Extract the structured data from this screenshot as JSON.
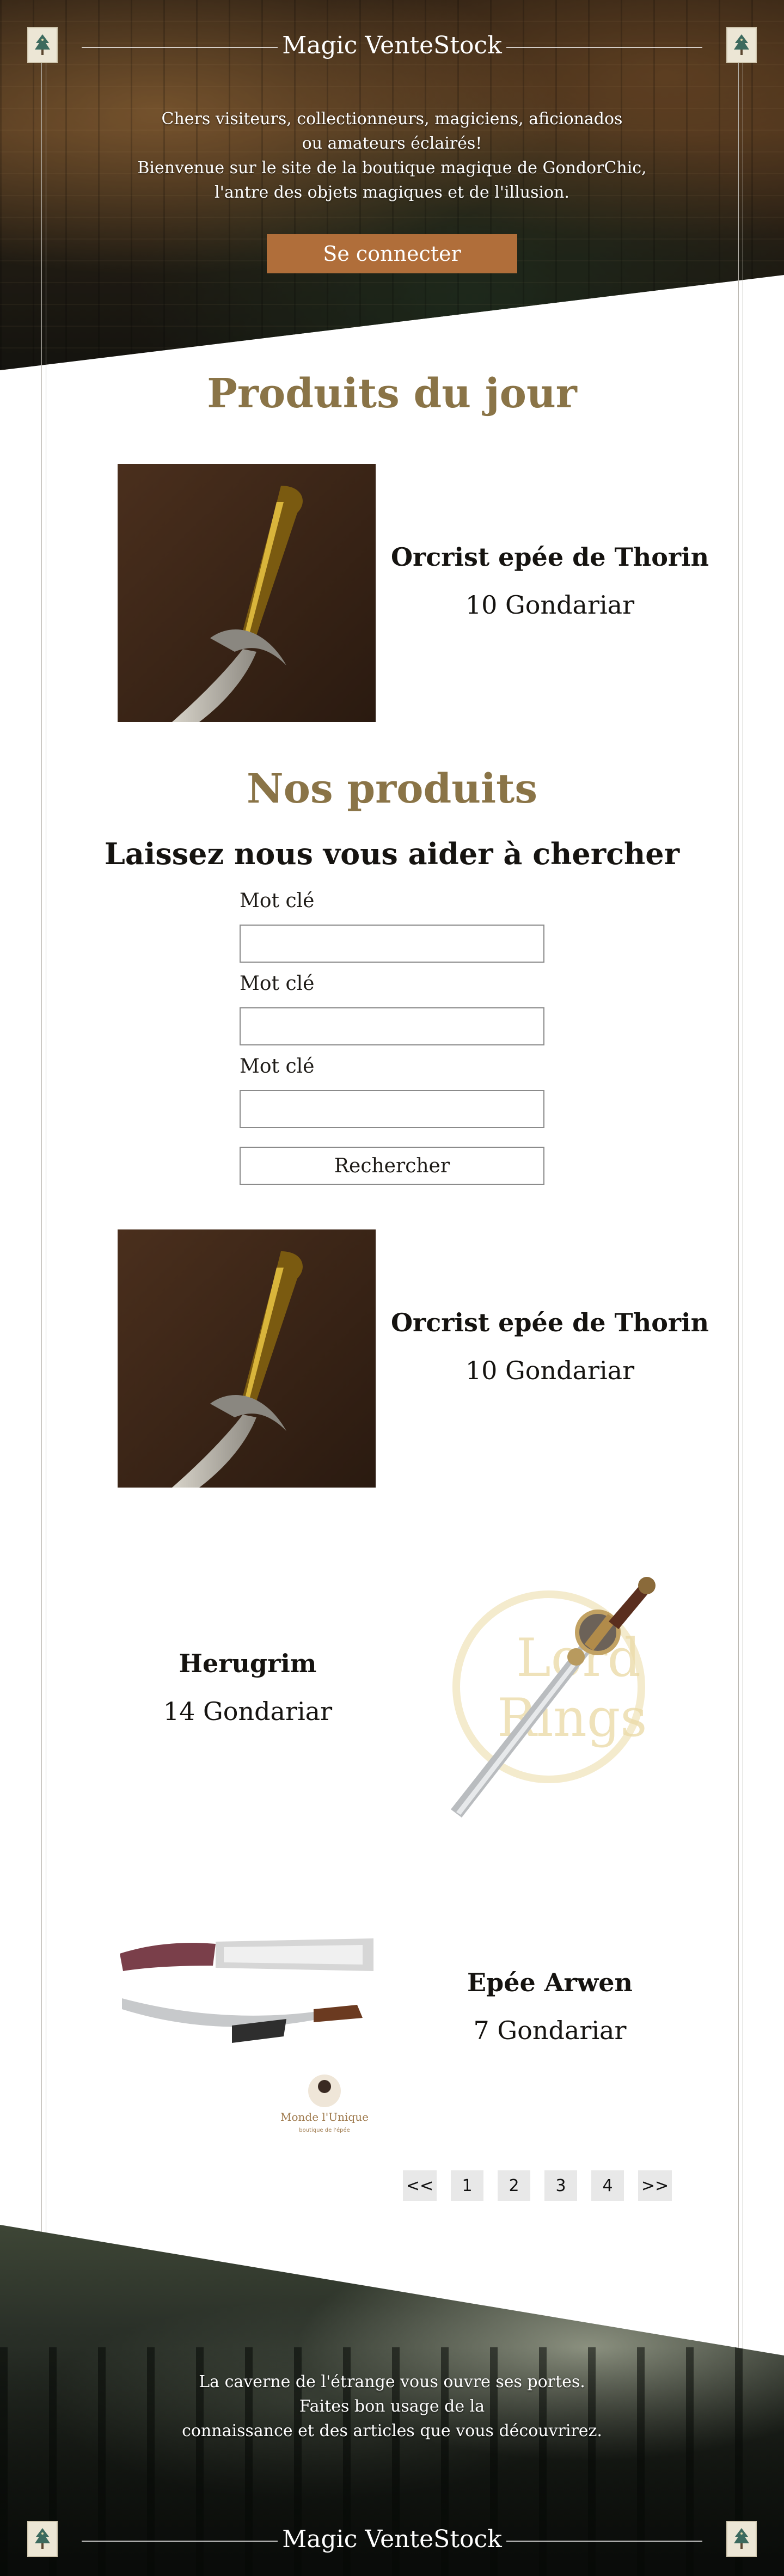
{
  "site": {
    "title": "Magic VenteStock"
  },
  "header": {
    "welcome_lines": [
      "Chers visiteurs, collectionneurs, magiciens, aficionados",
      "ou amateurs éclairés!",
      "Bienvenue sur le site de la boutique magique de GondorChic,",
      "l'antre des objets magiques et de l'illusion."
    ],
    "login_label": "Se connecter",
    "emblem_icon": "tree-emblem-icon"
  },
  "daily": {
    "heading": "Produits du jour",
    "product": {
      "name": "Orcrist epée de Thorin",
      "price": "10 Gondariar",
      "image_icon": "orcrist-sword-image"
    }
  },
  "catalog": {
    "heading": "Nos produits",
    "search_heading": "Laissez nous vous aider à chercher",
    "fields": [
      {
        "label": "Mot clé",
        "value": ""
      },
      {
        "label": "Mot clé",
        "value": ""
      },
      {
        "label": "Mot clé",
        "value": ""
      }
    ],
    "search_label": "Rechercher",
    "products": [
      {
        "name": "Orcrist epée de Thorin",
        "price": "10 Gondariar",
        "image_icon": "orcrist-sword-image"
      },
      {
        "name": "Herugrim",
        "price": "14 Gondariar",
        "image_icon": "herugrim-sword-image",
        "logo_text": [
          "Lord",
          "Rings"
        ]
      },
      {
        "name": "Epée Arwen",
        "price": "7 Gondariar",
        "image_icon": "arwen-sword-image",
        "logo_text": [
          "Monde l'Unique",
          "boutique de l'épée"
        ]
      }
    ],
    "pagination": [
      "<<",
      "1",
      "2",
      "3",
      "4",
      ">>"
    ]
  },
  "footer": {
    "lines": [
      "La caverne de l'étrange vous ouvre ses portes.",
      "Faites bon usage de la",
      "connaissance et des articles que vous découvrirez."
    ],
    "title": "Magic VenteStock"
  },
  "colors": {
    "gold_heading": "#8a7447",
    "button_brown": "#b06e3a",
    "pagination_bg": "#e8e8e8"
  }
}
